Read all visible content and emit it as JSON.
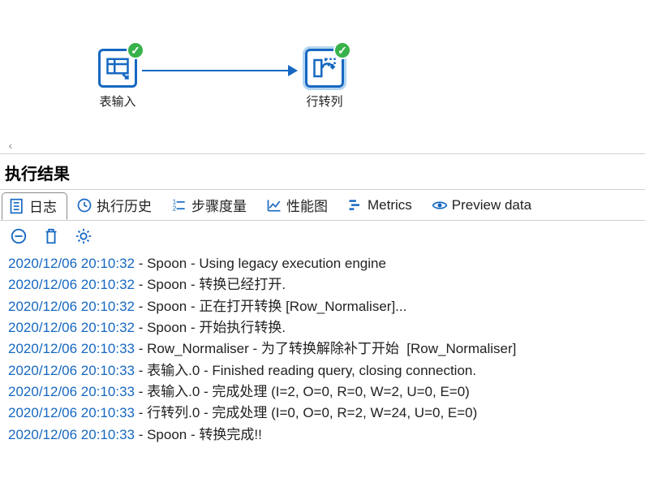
{
  "canvas": {
    "steps": [
      {
        "name": "input-step",
        "label": "表输入"
      },
      {
        "name": "pivot-step",
        "label": "行转列"
      }
    ]
  },
  "results_title": "执行结果",
  "tabs": [
    {
      "label": "日志",
      "name": "tab-log"
    },
    {
      "label": "执行历史",
      "name": "tab-history"
    },
    {
      "label": "步骤度量",
      "name": "tab-step-metrics"
    },
    {
      "label": "性能图",
      "name": "tab-perf-graph"
    },
    {
      "label": "Metrics",
      "name": "tab-metrics"
    },
    {
      "label": "Preview data",
      "name": "tab-preview"
    }
  ],
  "log": [
    {
      "ts": "2020/12/06 20:10:32",
      "msg": " - Spoon - Using legacy execution engine"
    },
    {
      "ts": "2020/12/06 20:10:32",
      "msg": " - Spoon - 转换已经打开."
    },
    {
      "ts": "2020/12/06 20:10:32",
      "msg": " - Spoon - 正在打开转换 [Row_Normaliser]..."
    },
    {
      "ts": "2020/12/06 20:10:32",
      "msg": " - Spoon - 开始执行转换."
    },
    {
      "ts": "2020/12/06 20:10:33",
      "msg": " - Row_Normaliser - 为了转换解除补丁开始  [Row_Normaliser]"
    },
    {
      "ts": "2020/12/06 20:10:33",
      "msg": " - 表输入.0 - Finished reading query, closing connection."
    },
    {
      "ts": "2020/12/06 20:10:33",
      "msg": " - 表输入.0 - 完成处理 (I=2, O=0, R=0, W=2, U=0, E=0)"
    },
    {
      "ts": "2020/12/06 20:10:33",
      "msg": " - 行转列.0 - 完成处理 (I=0, O=0, R=2, W=24, U=0, E=0)"
    },
    {
      "ts": "2020/12/06 20:10:33",
      "msg": " - Spoon - 转换完成!!"
    }
  ]
}
